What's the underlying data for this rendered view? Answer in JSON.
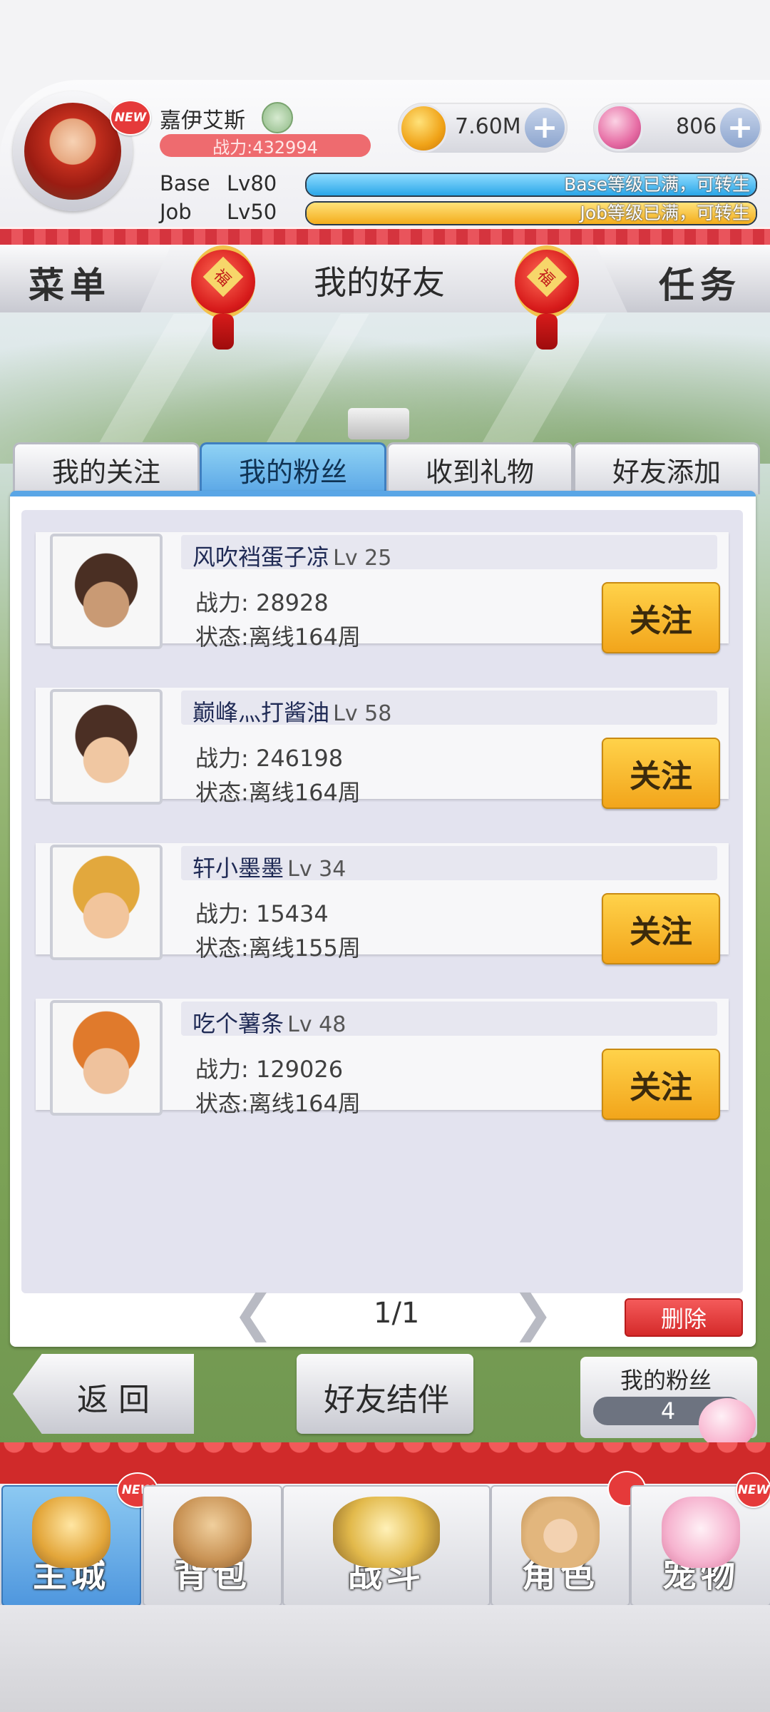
{
  "player": {
    "name": "嘉伊艾斯",
    "power": "战力:432994",
    "new_badge": "NEW",
    "zeny": "7.60M",
    "gems": "806",
    "base_label": "Base",
    "base_level": "Lv80",
    "base_bar_text": "Base等级已满，可转生",
    "base_bar_fill": 1.0,
    "job_label": "Job",
    "job_level": "Lv50",
    "job_bar_text": "Job等级已满，可转生",
    "job_bar_fill": 1.0
  },
  "nav": {
    "menu": "菜单",
    "title": "我的好友",
    "quest": "任务"
  },
  "tabs": [
    {
      "label": "我的关注",
      "active": false
    },
    {
      "label": "我的粉丝",
      "active": true
    },
    {
      "label": "收到礼物",
      "active": false
    },
    {
      "label": "好友添加",
      "active": false
    }
  ],
  "fans": [
    {
      "name": "风吹裆蛋子凉",
      "level": "Lv 25",
      "power": "战力: 28928",
      "status": "状态:离线164周",
      "button": "关注"
    },
    {
      "name": "巅峰灬打酱油",
      "level": "Lv 58",
      "power": "战力: 246198",
      "status": "状态:离线164周",
      "button": "关注"
    },
    {
      "name": "轩小墨墨",
      "level": "Lv 34",
      "power": "战力: 15434",
      "status": "状态:离线155周",
      "button": "关注"
    },
    {
      "name": "吃个薯条",
      "level": "Lv 48",
      "power": "战力: 129026",
      "status": "状态:离线164周",
      "button": "关注"
    }
  ],
  "pager": {
    "text": "1/1",
    "prev": "❮",
    "next": "❯",
    "delete": "删除"
  },
  "actions": {
    "back": "返 回",
    "companion": "好友结伴",
    "fans_label": "我的粉丝",
    "fans_count": "4"
  },
  "bottom_tabs": [
    {
      "label": "主城",
      "active": true,
      "badge": "NEW"
    },
    {
      "label": "背包",
      "active": false,
      "badge": ""
    },
    {
      "label": "战斗",
      "active": false,
      "badge": ""
    },
    {
      "label": "角色",
      "active": false,
      "badge": ""
    },
    {
      "label": "宠物",
      "active": false,
      "badge": "NEW"
    }
  ],
  "colors": {
    "accent_blue": "#5aa6e6",
    "follow_yellow": "#f2a51b",
    "delete_red": "#d52a2a",
    "power_pill": "#ee6b6f"
  }
}
